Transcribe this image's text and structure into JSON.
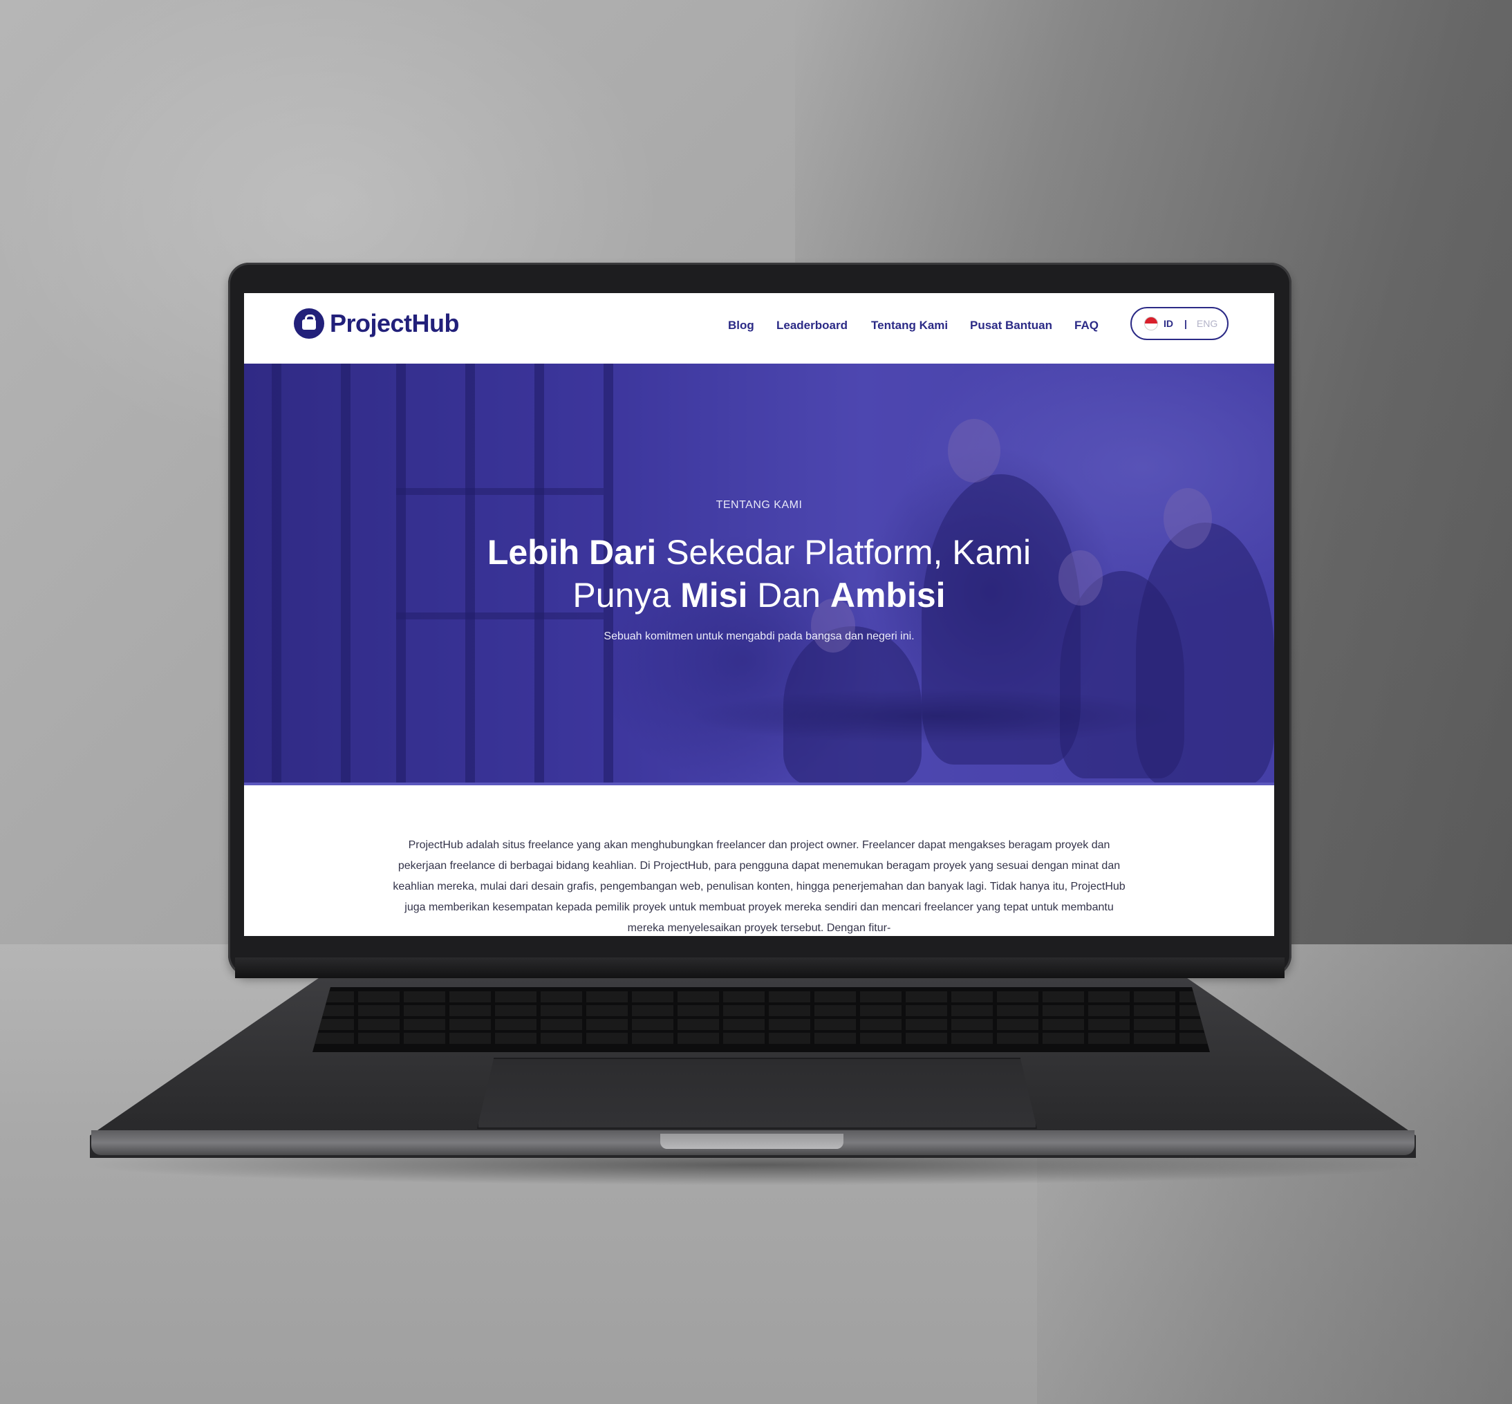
{
  "brand": {
    "name": "ProjectHub"
  },
  "nav": {
    "items": [
      "Blog",
      "Leaderboard",
      "Tentang Kami",
      "Pusat Bantuan",
      "FAQ"
    ]
  },
  "language": {
    "active": "ID",
    "separator": "|",
    "inactive": "ENG"
  },
  "hero": {
    "eyebrow": "TENTANG KAMI",
    "headline_line1_bold": "Lebih Dari",
    "headline_line1_regular": " Sekedar Platform, Kami",
    "headline_line2_a": "Punya ",
    "headline_line2_bold1": "Misi",
    "headline_line2_b": " Dan ",
    "headline_line2_bold2": "Ambisi",
    "subtitle": "Sebuah komitmen untuk mengabdi pada bangsa dan negeri ini."
  },
  "about": {
    "paragraph": "ProjectHub adalah situs freelance yang akan menghubungkan freelancer dan project owner. Freelancer dapat mengakses beragam proyek dan pekerjaan freelance di berbagai bidang keahlian. Di ProjectHub, para pengguna dapat menemukan beragam proyek yang sesuai dengan minat dan keahlian mereka, mulai dari desain grafis, pengembangan web, penulisan konten, hingga penerjemahan dan banyak lagi. Tidak hanya itu, ProjectHub juga memberikan kesempatan kepada pemilik proyek untuk membuat proyek mereka sendiri dan mencari freelancer yang tepat untuk membantu mereka menyelesaikan proyek tersebut. Dengan fitur-"
  },
  "colors": {
    "brand_navy": "#22207a",
    "nav_link": "#2b2a86",
    "hero_tint": "#3d3896"
  },
  "icons": [
    "projecthub-logo-icon",
    "indonesia-flag-icon"
  ]
}
